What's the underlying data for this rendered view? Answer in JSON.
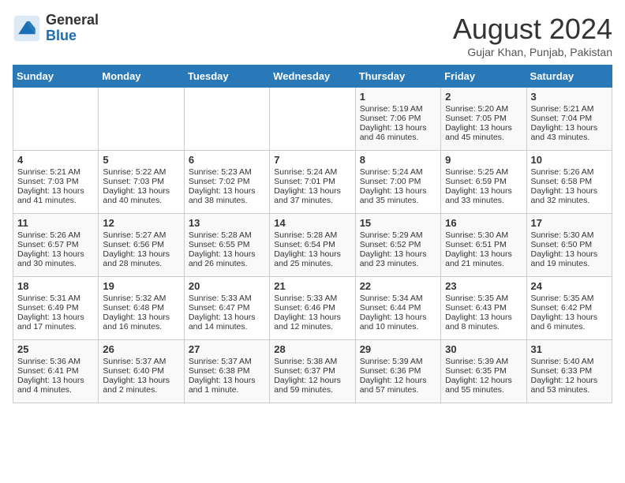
{
  "header": {
    "logo_general": "General",
    "logo_blue": "Blue",
    "title": "August 2024",
    "location": "Gujar Khan, Punjab, Pakistan"
  },
  "weekdays": [
    "Sunday",
    "Monday",
    "Tuesday",
    "Wednesday",
    "Thursday",
    "Friday",
    "Saturday"
  ],
  "weeks": [
    [
      {
        "day": "",
        "info": ""
      },
      {
        "day": "",
        "info": ""
      },
      {
        "day": "",
        "info": ""
      },
      {
        "day": "",
        "info": ""
      },
      {
        "day": "1",
        "info": "Sunrise: 5:19 AM\nSunset: 7:06 PM\nDaylight: 13 hours\nand 46 minutes."
      },
      {
        "day": "2",
        "info": "Sunrise: 5:20 AM\nSunset: 7:05 PM\nDaylight: 13 hours\nand 45 minutes."
      },
      {
        "day": "3",
        "info": "Sunrise: 5:21 AM\nSunset: 7:04 PM\nDaylight: 13 hours\nand 43 minutes."
      }
    ],
    [
      {
        "day": "4",
        "info": "Sunrise: 5:21 AM\nSunset: 7:03 PM\nDaylight: 13 hours\nand 41 minutes."
      },
      {
        "day": "5",
        "info": "Sunrise: 5:22 AM\nSunset: 7:03 PM\nDaylight: 13 hours\nand 40 minutes."
      },
      {
        "day": "6",
        "info": "Sunrise: 5:23 AM\nSunset: 7:02 PM\nDaylight: 13 hours\nand 38 minutes."
      },
      {
        "day": "7",
        "info": "Sunrise: 5:24 AM\nSunset: 7:01 PM\nDaylight: 13 hours\nand 37 minutes."
      },
      {
        "day": "8",
        "info": "Sunrise: 5:24 AM\nSunset: 7:00 PM\nDaylight: 13 hours\nand 35 minutes."
      },
      {
        "day": "9",
        "info": "Sunrise: 5:25 AM\nSunset: 6:59 PM\nDaylight: 13 hours\nand 33 minutes."
      },
      {
        "day": "10",
        "info": "Sunrise: 5:26 AM\nSunset: 6:58 PM\nDaylight: 13 hours\nand 32 minutes."
      }
    ],
    [
      {
        "day": "11",
        "info": "Sunrise: 5:26 AM\nSunset: 6:57 PM\nDaylight: 13 hours\nand 30 minutes."
      },
      {
        "day": "12",
        "info": "Sunrise: 5:27 AM\nSunset: 6:56 PM\nDaylight: 13 hours\nand 28 minutes."
      },
      {
        "day": "13",
        "info": "Sunrise: 5:28 AM\nSunset: 6:55 PM\nDaylight: 13 hours\nand 26 minutes."
      },
      {
        "day": "14",
        "info": "Sunrise: 5:28 AM\nSunset: 6:54 PM\nDaylight: 13 hours\nand 25 minutes."
      },
      {
        "day": "15",
        "info": "Sunrise: 5:29 AM\nSunset: 6:52 PM\nDaylight: 13 hours\nand 23 minutes."
      },
      {
        "day": "16",
        "info": "Sunrise: 5:30 AM\nSunset: 6:51 PM\nDaylight: 13 hours\nand 21 minutes."
      },
      {
        "day": "17",
        "info": "Sunrise: 5:30 AM\nSunset: 6:50 PM\nDaylight: 13 hours\nand 19 minutes."
      }
    ],
    [
      {
        "day": "18",
        "info": "Sunrise: 5:31 AM\nSunset: 6:49 PM\nDaylight: 13 hours\nand 17 minutes."
      },
      {
        "day": "19",
        "info": "Sunrise: 5:32 AM\nSunset: 6:48 PM\nDaylight: 13 hours\nand 16 minutes."
      },
      {
        "day": "20",
        "info": "Sunrise: 5:33 AM\nSunset: 6:47 PM\nDaylight: 13 hours\nand 14 minutes."
      },
      {
        "day": "21",
        "info": "Sunrise: 5:33 AM\nSunset: 6:46 PM\nDaylight: 13 hours\nand 12 minutes."
      },
      {
        "day": "22",
        "info": "Sunrise: 5:34 AM\nSunset: 6:44 PM\nDaylight: 13 hours\nand 10 minutes."
      },
      {
        "day": "23",
        "info": "Sunrise: 5:35 AM\nSunset: 6:43 PM\nDaylight: 13 hours\nand 8 minutes."
      },
      {
        "day": "24",
        "info": "Sunrise: 5:35 AM\nSunset: 6:42 PM\nDaylight: 13 hours\nand 6 minutes."
      }
    ],
    [
      {
        "day": "25",
        "info": "Sunrise: 5:36 AM\nSunset: 6:41 PM\nDaylight: 13 hours\nand 4 minutes."
      },
      {
        "day": "26",
        "info": "Sunrise: 5:37 AM\nSunset: 6:40 PM\nDaylight: 13 hours\nand 2 minutes."
      },
      {
        "day": "27",
        "info": "Sunrise: 5:37 AM\nSunset: 6:38 PM\nDaylight: 13 hours\nand 1 minute."
      },
      {
        "day": "28",
        "info": "Sunrise: 5:38 AM\nSunset: 6:37 PM\nDaylight: 12 hours\nand 59 minutes."
      },
      {
        "day": "29",
        "info": "Sunrise: 5:39 AM\nSunset: 6:36 PM\nDaylight: 12 hours\nand 57 minutes."
      },
      {
        "day": "30",
        "info": "Sunrise: 5:39 AM\nSunset: 6:35 PM\nDaylight: 12 hours\nand 55 minutes."
      },
      {
        "day": "31",
        "info": "Sunrise: 5:40 AM\nSunset: 6:33 PM\nDaylight: 12 hours\nand 53 minutes."
      }
    ]
  ]
}
